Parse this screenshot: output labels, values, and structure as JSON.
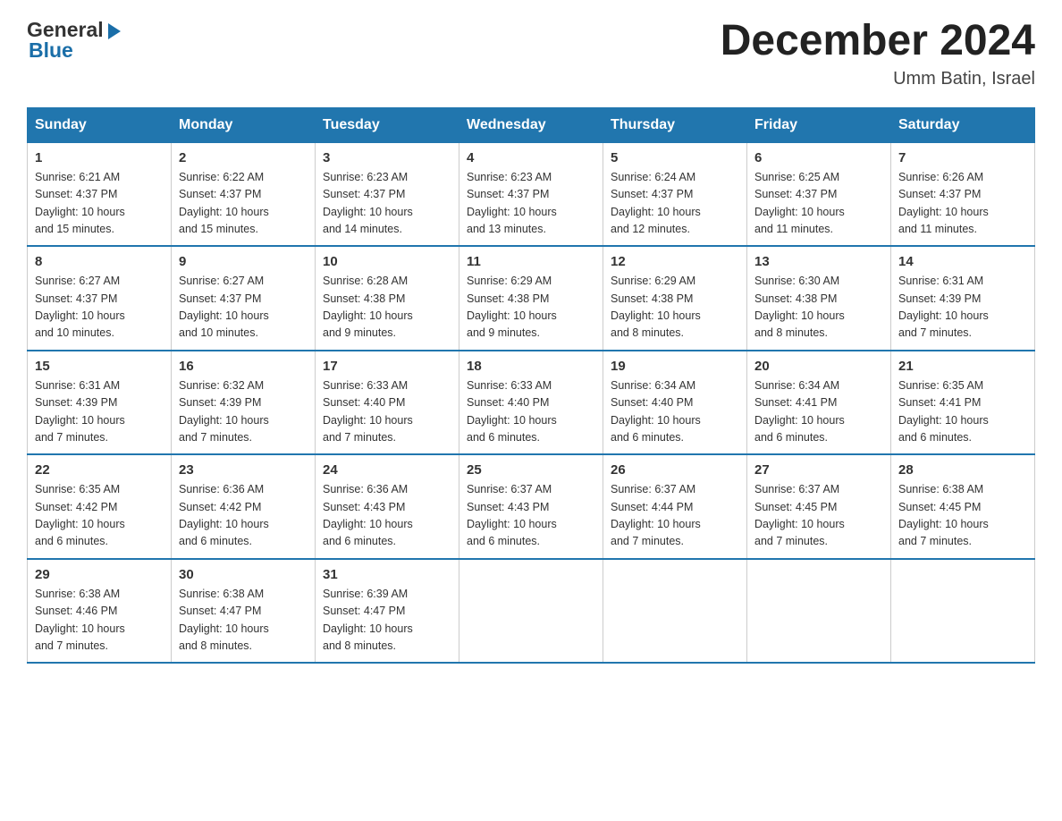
{
  "header": {
    "logo": {
      "general": "General",
      "blue": "Blue"
    },
    "title": "December 2024",
    "subtitle": "Umm Batin, Israel"
  },
  "days_of_week": [
    "Sunday",
    "Monday",
    "Tuesday",
    "Wednesday",
    "Thursday",
    "Friday",
    "Saturday"
  ],
  "weeks": [
    [
      {
        "day": "1",
        "sunrise": "6:21 AM",
        "sunset": "4:37 PM",
        "daylight": "10 hours and 15 minutes."
      },
      {
        "day": "2",
        "sunrise": "6:22 AM",
        "sunset": "4:37 PM",
        "daylight": "10 hours and 15 minutes."
      },
      {
        "day": "3",
        "sunrise": "6:23 AM",
        "sunset": "4:37 PM",
        "daylight": "10 hours and 14 minutes."
      },
      {
        "day": "4",
        "sunrise": "6:23 AM",
        "sunset": "4:37 PM",
        "daylight": "10 hours and 13 minutes."
      },
      {
        "day": "5",
        "sunrise": "6:24 AM",
        "sunset": "4:37 PM",
        "daylight": "10 hours and 12 minutes."
      },
      {
        "day": "6",
        "sunrise": "6:25 AM",
        "sunset": "4:37 PM",
        "daylight": "10 hours and 11 minutes."
      },
      {
        "day": "7",
        "sunrise": "6:26 AM",
        "sunset": "4:37 PM",
        "daylight": "10 hours and 11 minutes."
      }
    ],
    [
      {
        "day": "8",
        "sunrise": "6:27 AM",
        "sunset": "4:37 PM",
        "daylight": "10 hours and 10 minutes."
      },
      {
        "day": "9",
        "sunrise": "6:27 AM",
        "sunset": "4:37 PM",
        "daylight": "10 hours and 10 minutes."
      },
      {
        "day": "10",
        "sunrise": "6:28 AM",
        "sunset": "4:38 PM",
        "daylight": "10 hours and 9 minutes."
      },
      {
        "day": "11",
        "sunrise": "6:29 AM",
        "sunset": "4:38 PM",
        "daylight": "10 hours and 9 minutes."
      },
      {
        "day": "12",
        "sunrise": "6:29 AM",
        "sunset": "4:38 PM",
        "daylight": "10 hours and 8 minutes."
      },
      {
        "day": "13",
        "sunrise": "6:30 AM",
        "sunset": "4:38 PM",
        "daylight": "10 hours and 8 minutes."
      },
      {
        "day": "14",
        "sunrise": "6:31 AM",
        "sunset": "4:39 PM",
        "daylight": "10 hours and 7 minutes."
      }
    ],
    [
      {
        "day": "15",
        "sunrise": "6:31 AM",
        "sunset": "4:39 PM",
        "daylight": "10 hours and 7 minutes."
      },
      {
        "day": "16",
        "sunrise": "6:32 AM",
        "sunset": "4:39 PM",
        "daylight": "10 hours and 7 minutes."
      },
      {
        "day": "17",
        "sunrise": "6:33 AM",
        "sunset": "4:40 PM",
        "daylight": "10 hours and 7 minutes."
      },
      {
        "day": "18",
        "sunrise": "6:33 AM",
        "sunset": "4:40 PM",
        "daylight": "10 hours and 6 minutes."
      },
      {
        "day": "19",
        "sunrise": "6:34 AM",
        "sunset": "4:40 PM",
        "daylight": "10 hours and 6 minutes."
      },
      {
        "day": "20",
        "sunrise": "6:34 AM",
        "sunset": "4:41 PM",
        "daylight": "10 hours and 6 minutes."
      },
      {
        "day": "21",
        "sunrise": "6:35 AM",
        "sunset": "4:41 PM",
        "daylight": "10 hours and 6 minutes."
      }
    ],
    [
      {
        "day": "22",
        "sunrise": "6:35 AM",
        "sunset": "4:42 PM",
        "daylight": "10 hours and 6 minutes."
      },
      {
        "day": "23",
        "sunrise": "6:36 AM",
        "sunset": "4:42 PM",
        "daylight": "10 hours and 6 minutes."
      },
      {
        "day": "24",
        "sunrise": "6:36 AM",
        "sunset": "4:43 PM",
        "daylight": "10 hours and 6 minutes."
      },
      {
        "day": "25",
        "sunrise": "6:37 AM",
        "sunset": "4:43 PM",
        "daylight": "10 hours and 6 minutes."
      },
      {
        "day": "26",
        "sunrise": "6:37 AM",
        "sunset": "4:44 PM",
        "daylight": "10 hours and 7 minutes."
      },
      {
        "day": "27",
        "sunrise": "6:37 AM",
        "sunset": "4:45 PM",
        "daylight": "10 hours and 7 minutes."
      },
      {
        "day": "28",
        "sunrise": "6:38 AM",
        "sunset": "4:45 PM",
        "daylight": "10 hours and 7 minutes."
      }
    ],
    [
      {
        "day": "29",
        "sunrise": "6:38 AM",
        "sunset": "4:46 PM",
        "daylight": "10 hours and 7 minutes."
      },
      {
        "day": "30",
        "sunrise": "6:38 AM",
        "sunset": "4:47 PM",
        "daylight": "10 hours and 8 minutes."
      },
      {
        "day": "31",
        "sunrise": "6:39 AM",
        "sunset": "4:47 PM",
        "daylight": "10 hours and 8 minutes."
      },
      null,
      null,
      null,
      null
    ]
  ],
  "labels": {
    "sunrise": "Sunrise:",
    "sunset": "Sunset:",
    "daylight": "Daylight:"
  }
}
